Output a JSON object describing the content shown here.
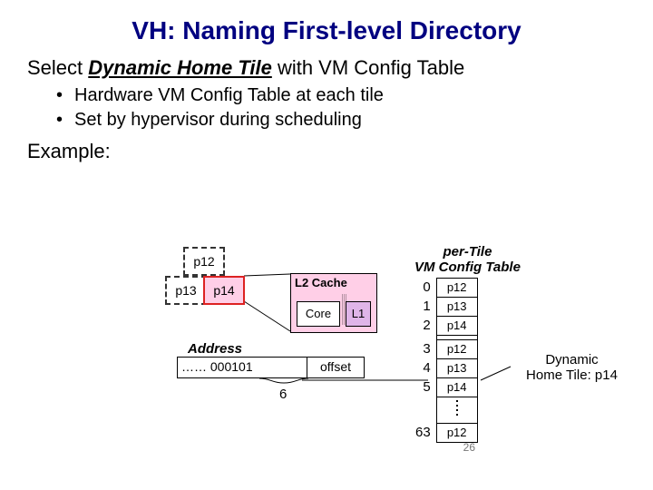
{
  "title": "VH: Naming First-level Directory",
  "lead_prefix": "Select ",
  "lead_dht": "Dynamic Home Tile",
  "lead_suffix": " with VM Config Table",
  "bullets": [
    "Hardware VM Config Table at each tile",
    "Set by hypervisor during scheduling"
  ],
  "example_label": "Example:",
  "tiles": {
    "p12": "p12",
    "p13": "p13",
    "p14": "p14"
  },
  "l2": {
    "label": "L2 Cache",
    "core": "Core",
    "l1": "L1"
  },
  "addr": {
    "label": "Address",
    "bits": "…… 000101",
    "offset": "offset",
    "index_bits": "6"
  },
  "cfg": {
    "caption1": "per-Tile",
    "caption2": "VM Config Table",
    "rows": [
      {
        "i": "0",
        "v": "p12"
      },
      {
        "i": "1",
        "v": "p13"
      },
      {
        "i": "2",
        "v": "p14"
      },
      {
        "i": "3",
        "v": "p12"
      },
      {
        "i": "4",
        "v": "p13"
      },
      {
        "i": "5",
        "v": "p14"
      }
    ],
    "last": {
      "i": "63",
      "v": "p12"
    }
  },
  "result": {
    "line1": "Dynamic",
    "line2": "Home Tile: p14"
  },
  "page_no": "26"
}
